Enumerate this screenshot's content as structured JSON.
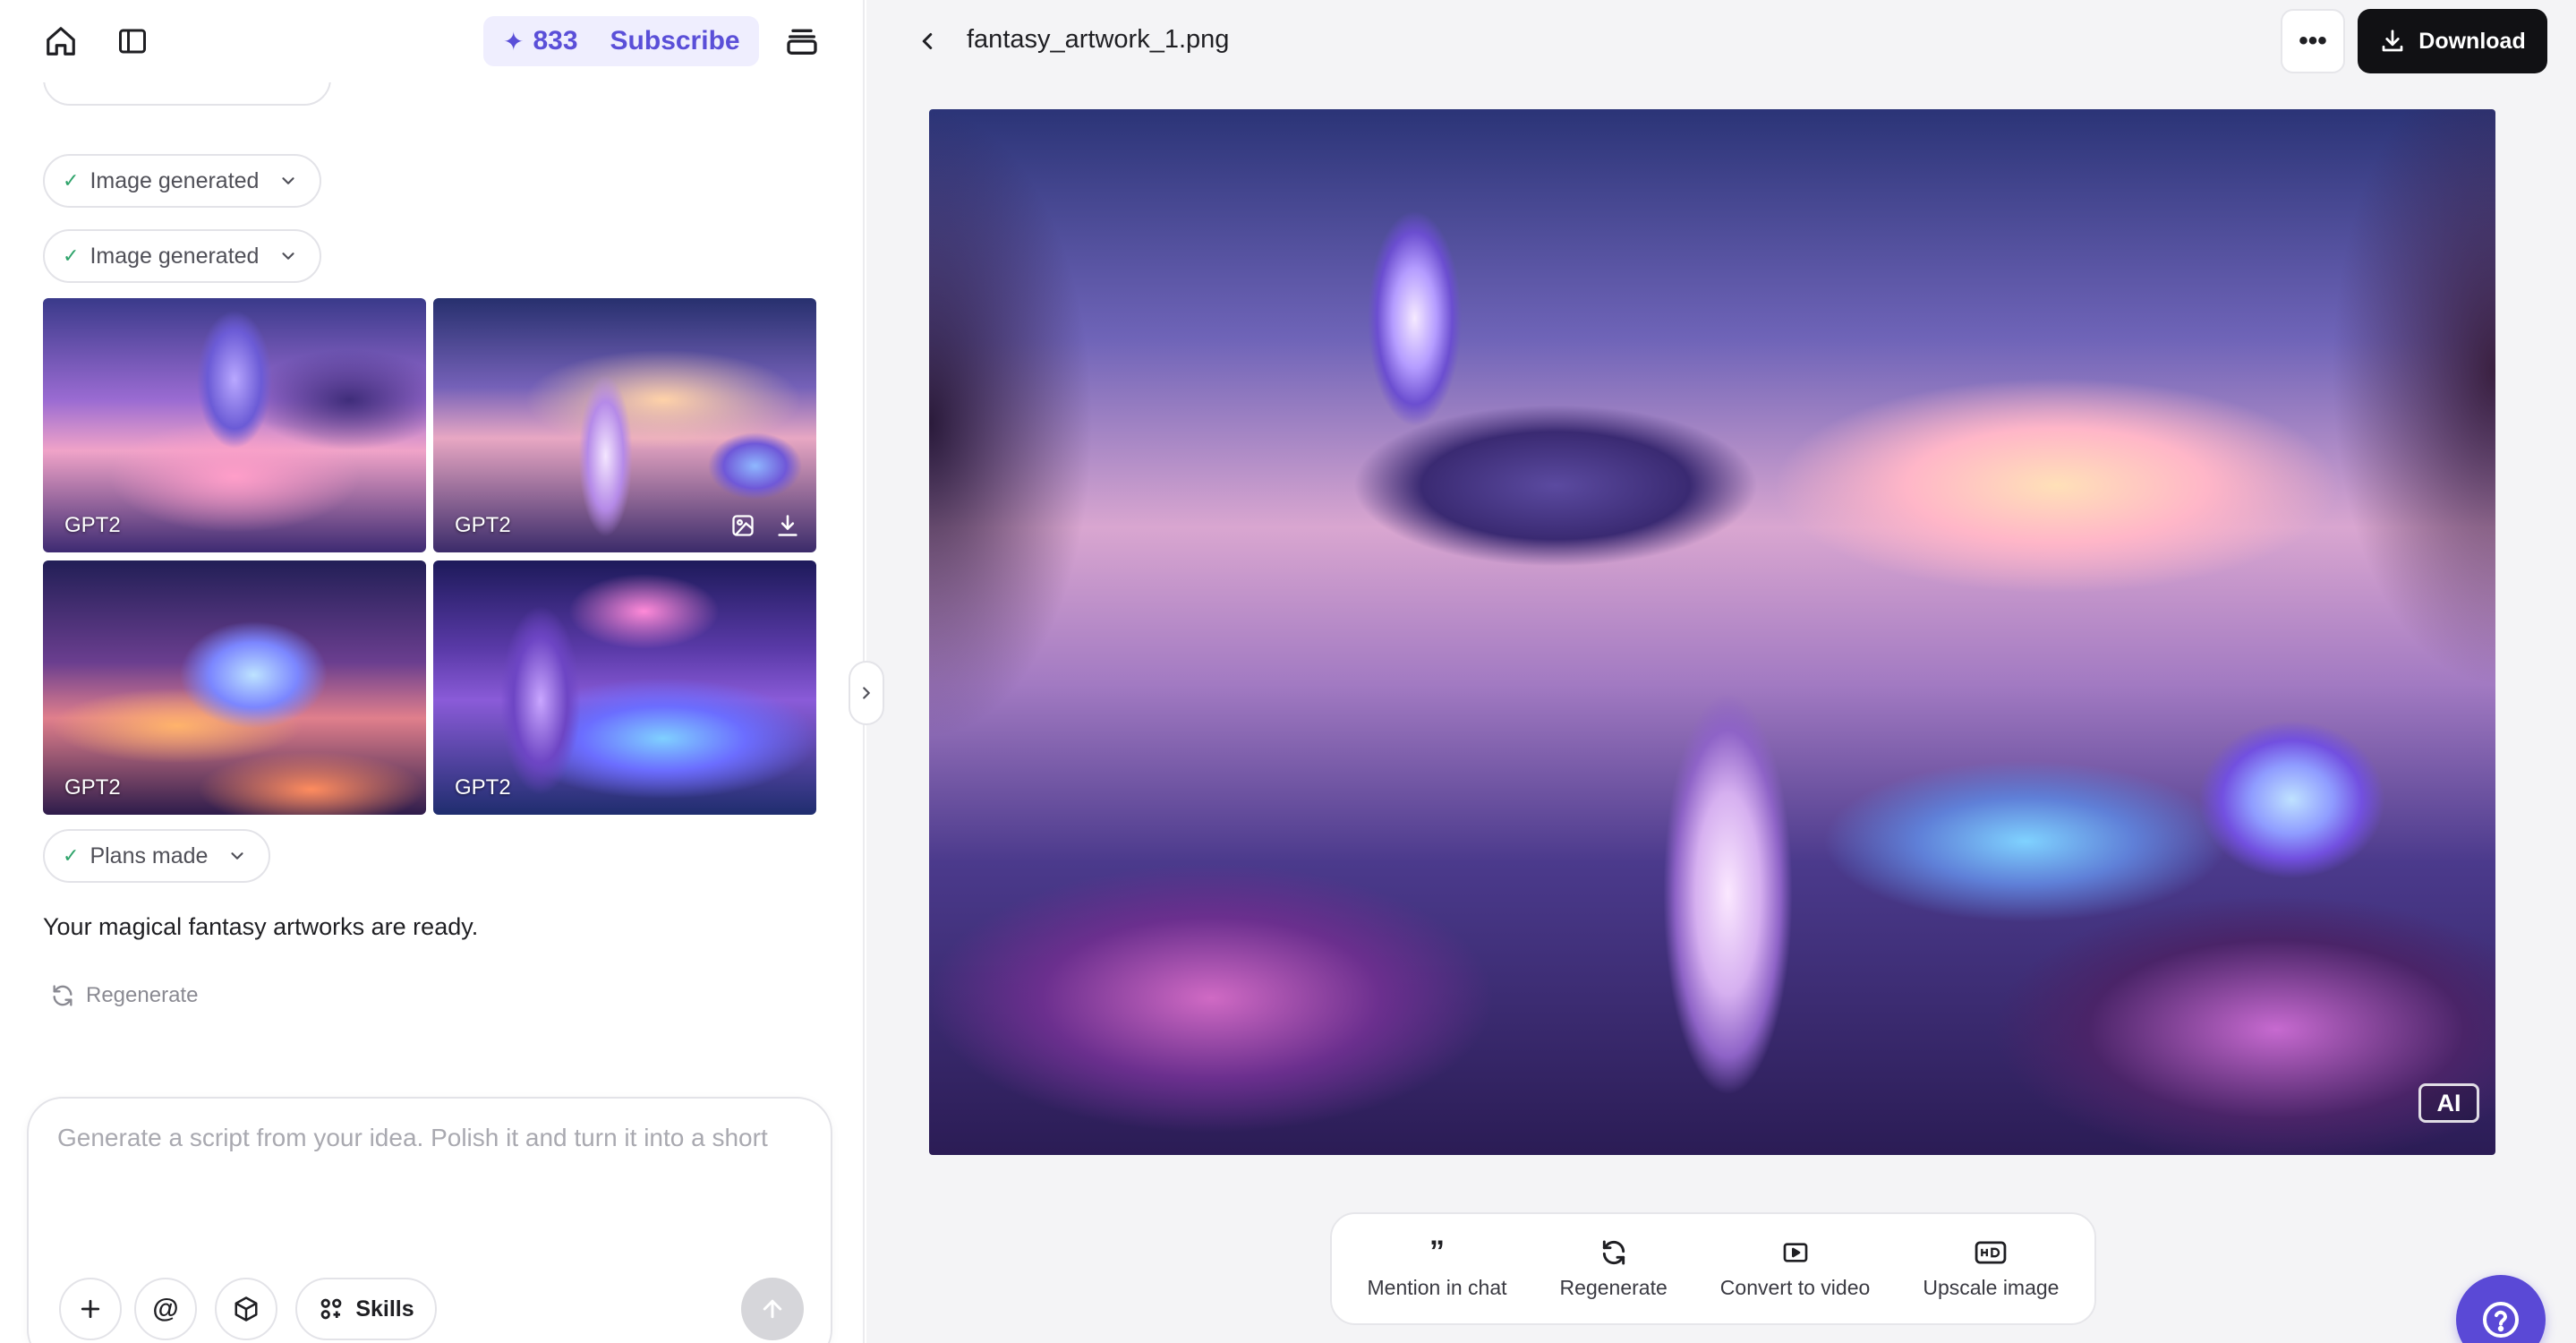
{
  "sidebar": {
    "credits": "833",
    "subscribe_label": "Subscribe",
    "status_chips": [
      {
        "label": "Image generated"
      },
      {
        "label": "Image generated"
      },
      {
        "label": "Plans made"
      }
    ],
    "thumbnails": [
      {
        "model": "GPT2"
      },
      {
        "model": "GPT2"
      },
      {
        "model": "GPT2"
      },
      {
        "model": "GPT2"
      }
    ],
    "reply_text": "Your magical fantasy artworks are ready.",
    "regenerate_label": "Regenerate"
  },
  "composer": {
    "placeholder": "Generate a script from your idea. Polish it and turn it into a short",
    "skills_label": "Skills"
  },
  "viewer": {
    "file_name": "fantasy_artwork_1.png",
    "download_label": "Download",
    "ai_badge": "AI",
    "actions": [
      {
        "label": "Mention in chat",
        "icon": "quote-icon"
      },
      {
        "label": "Regenerate",
        "icon": "refresh-icon"
      },
      {
        "label": "Convert to video",
        "icon": "video-icon"
      },
      {
        "label": "Upscale image",
        "icon": "hd-icon"
      }
    ]
  },
  "colors": {
    "accent": "#5a4fd8",
    "download_bg": "#111114",
    "success": "#2ea36a"
  }
}
